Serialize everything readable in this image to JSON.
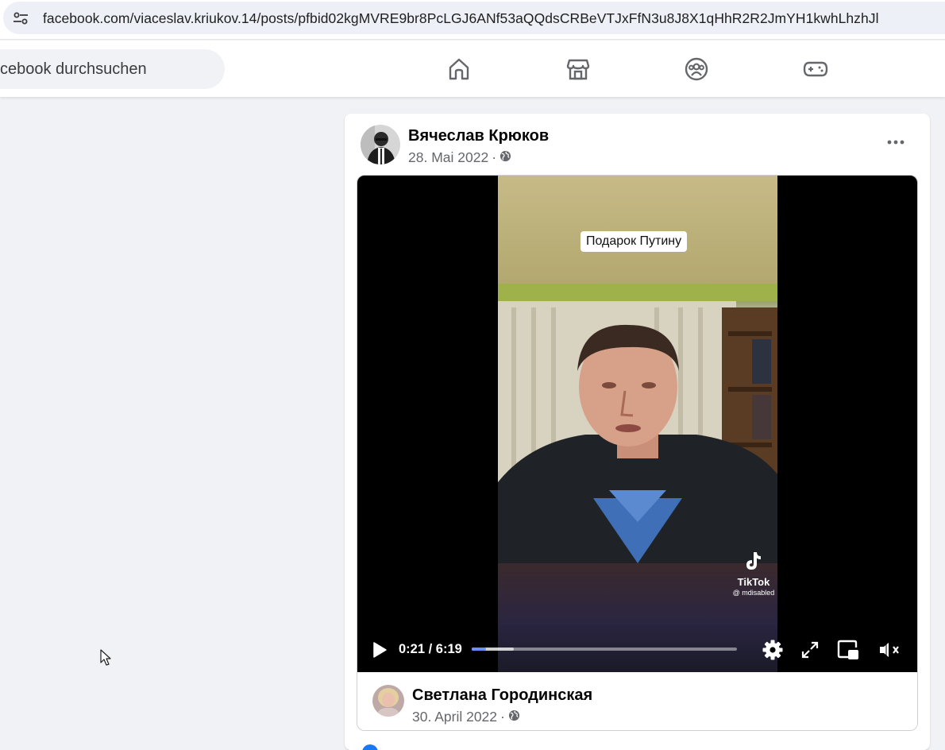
{
  "browser": {
    "url": "facebook.com/viaceslav.kriukov.14/posts/pfbid02kgMVRE9br8PcLGJ6ANf53aQQdsCRBeVTJxFfN3u8J8X1qHhR2R2JmYH1kwhLhzhJl"
  },
  "header": {
    "search_text": "cebook durchsuchen",
    "nav_icons": [
      "home-icon",
      "marketplace-icon",
      "groups-icon",
      "gaming-icon"
    ]
  },
  "post": {
    "author": "Вячеслав Крюков",
    "date": "28. Mai 2022",
    "separator": "·",
    "audience_icon": "globe-icon"
  },
  "video": {
    "caption": "Подарок Путину",
    "watermark_brand": "TikTok",
    "watermark_handle": "@ mdisabled",
    "time_display": "0:21 / 6:19",
    "progress_fraction": 0.0553,
    "buffer_fraction": 0.16,
    "controls": [
      "play-icon",
      "settings-icon",
      "fullscreen-icon",
      "picture-in-picture-icon",
      "muted-volume-icon"
    ]
  },
  "shared": {
    "author": "Светлана Городинская",
    "date": "30. April 2022",
    "separator": "·",
    "audience_icon": "globe-icon"
  },
  "colors": {
    "facebook_blue": "#1877f2",
    "progress_blue": "#6a8fff",
    "secondary_text": "#65676b"
  }
}
